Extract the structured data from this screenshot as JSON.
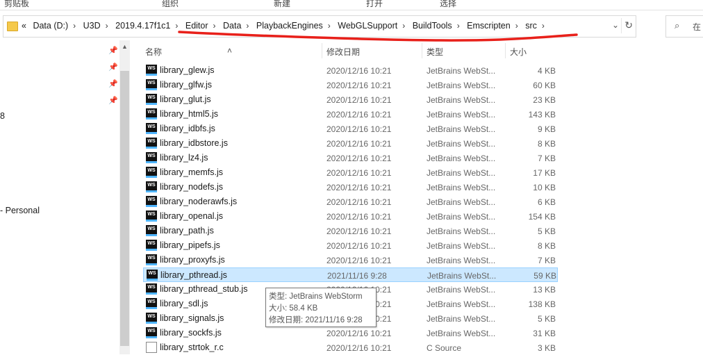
{
  "ribbon": {
    "groups": [
      "剪贴板",
      "组织",
      "新建",
      "打开",
      "选择"
    ]
  },
  "address": {
    "lead": "«",
    "crumbs": [
      "Data (D:)",
      "U3D",
      "2019.4.17f1c1",
      "Editor",
      "Data",
      "PlaybackEngines",
      "WebGLSupport",
      "BuildTools",
      "Emscripten",
      "src"
    ],
    "separator": "›"
  },
  "search": {
    "placeholder": "在"
  },
  "nav": {
    "fragment_1": "8",
    "fragment_2": "- Personal"
  },
  "columns": {
    "name": "名称",
    "date": "修改日期",
    "type": "类型",
    "size": "大小"
  },
  "files": [
    {
      "name": "library_glew.js",
      "date": "2020/12/16 10:21",
      "type": "JetBrains WebSt...",
      "size": "4 KB",
      "icon": "webstorm-file-icon"
    },
    {
      "name": "library_glfw.js",
      "date": "2020/12/16 10:21",
      "type": "JetBrains WebSt...",
      "size": "60 KB",
      "icon": "webstorm-file-icon"
    },
    {
      "name": "library_glut.js",
      "date": "2020/12/16 10:21",
      "type": "JetBrains WebSt...",
      "size": "23 KB",
      "icon": "webstorm-file-icon"
    },
    {
      "name": "library_html5.js",
      "date": "2020/12/16 10:21",
      "type": "JetBrains WebSt...",
      "size": "143 KB",
      "icon": "webstorm-file-icon"
    },
    {
      "name": "library_idbfs.js",
      "date": "2020/12/16 10:21",
      "type": "JetBrains WebSt...",
      "size": "9 KB",
      "icon": "webstorm-file-icon"
    },
    {
      "name": "library_idbstore.js",
      "date": "2020/12/16 10:21",
      "type": "JetBrains WebSt...",
      "size": "8 KB",
      "icon": "webstorm-file-icon"
    },
    {
      "name": "library_lz4.js",
      "date": "2020/12/16 10:21",
      "type": "JetBrains WebSt...",
      "size": "7 KB",
      "icon": "webstorm-file-icon"
    },
    {
      "name": "library_memfs.js",
      "date": "2020/12/16 10:21",
      "type": "JetBrains WebSt...",
      "size": "17 KB",
      "icon": "webstorm-file-icon"
    },
    {
      "name": "library_nodefs.js",
      "date": "2020/12/16 10:21",
      "type": "JetBrains WebSt...",
      "size": "10 KB",
      "icon": "webstorm-file-icon"
    },
    {
      "name": "library_noderawfs.js",
      "date": "2020/12/16 10:21",
      "type": "JetBrains WebSt...",
      "size": "6 KB",
      "icon": "webstorm-file-icon"
    },
    {
      "name": "library_openal.js",
      "date": "2020/12/16 10:21",
      "type": "JetBrains WebSt...",
      "size": "154 KB",
      "icon": "webstorm-file-icon"
    },
    {
      "name": "library_path.js",
      "date": "2020/12/16 10:21",
      "type": "JetBrains WebSt...",
      "size": "5 KB",
      "icon": "webstorm-file-icon"
    },
    {
      "name": "library_pipefs.js",
      "date": "2020/12/16 10:21",
      "type": "JetBrains WebSt...",
      "size": "8 KB",
      "icon": "webstorm-file-icon"
    },
    {
      "name": "library_proxyfs.js",
      "date": "2020/12/16 10:21",
      "type": "JetBrains WebSt...",
      "size": "7 KB",
      "icon": "webstorm-file-icon"
    },
    {
      "name": "library_pthread.js",
      "date": "2021/11/16 9:28",
      "type": "JetBrains WebSt...",
      "size": "59 KB",
      "icon": "webstorm-file-icon",
      "selected": true
    },
    {
      "name": "library_pthread_stub.js",
      "date": "2020/12/16 10:21",
      "type": "JetBrains WebSt...",
      "size": "13 KB",
      "icon": "webstorm-file-icon"
    },
    {
      "name": "library_sdl.js",
      "date": "2020/12/16 10:21",
      "type": "JetBrains WebSt...",
      "size": "138 KB",
      "icon": "webstorm-file-icon"
    },
    {
      "name": "library_signals.js",
      "date": "2020/12/16 10:21",
      "type": "JetBrains WebSt...",
      "size": "5 KB",
      "icon": "webstorm-file-icon"
    },
    {
      "name": "library_sockfs.js",
      "date": "2020/12/16 10:21",
      "type": "JetBrains WebSt...",
      "size": "31 KB",
      "icon": "webstorm-file-icon"
    },
    {
      "name": "library_strtok_r.c",
      "date": "2020/12/16 10:21",
      "type": "C Source",
      "size": "3 KB",
      "icon": "c-source-file-icon"
    }
  ],
  "tooltip": {
    "type_line": "类型: JetBrains WebStorm",
    "size_line": "大小: 58.4 KB",
    "date_line": "修改日期: 2021/11/16 9:28"
  },
  "icon_glyph": "WS",
  "colors": {
    "selection": "#cce8ff",
    "selection_border": "#99d1ff",
    "annotation": "#e8201a"
  }
}
